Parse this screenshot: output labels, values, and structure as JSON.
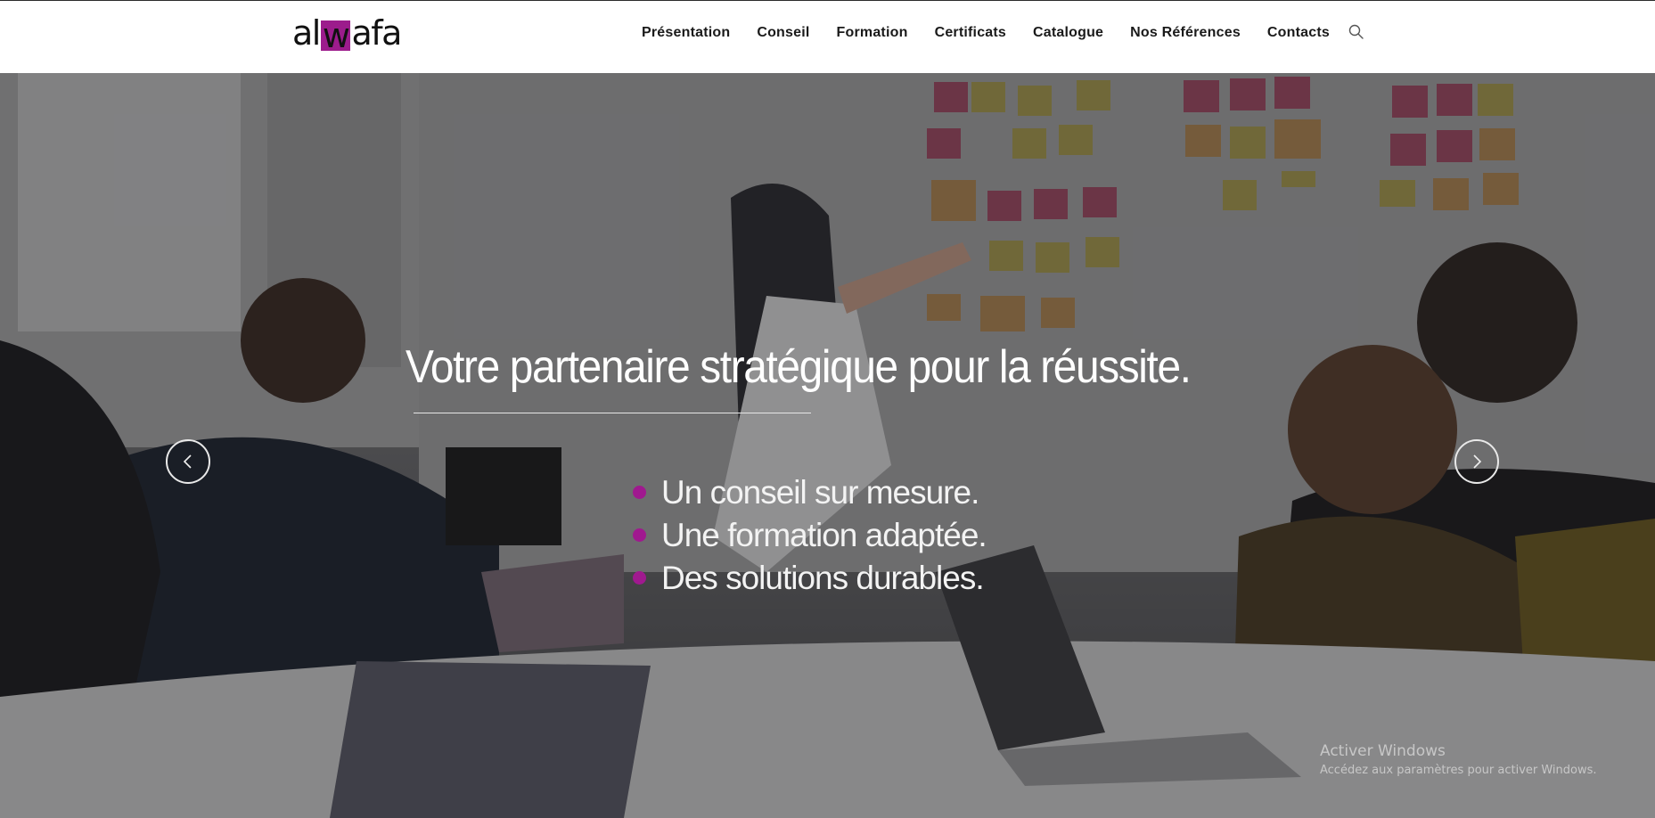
{
  "header": {
    "logo": {
      "part1": "al",
      "highlight": "w",
      "part2": "afa"
    },
    "nav": [
      "Présentation",
      "Conseil",
      "Formation",
      "Certificats",
      "Catalogue",
      "Nos Références",
      "Contacts"
    ],
    "search_icon": "search-icon"
  },
  "hero": {
    "headline": "Votre partenaire stratégique pour la réussite.",
    "bullets": [
      "Un conseil sur mesure.",
      "Une formation adaptée.",
      "Des solutions durables."
    ],
    "prev_icon": "chevron-left-icon",
    "next_icon": "chevron-right-icon"
  },
  "watermark": {
    "title": "Activer Windows",
    "subtitle": "Accédez aux paramètres pour activer Windows."
  },
  "colors": {
    "accent": "#9c1c8c",
    "nav_text": "#1a1a1a",
    "hero_text": "#ffffff"
  }
}
